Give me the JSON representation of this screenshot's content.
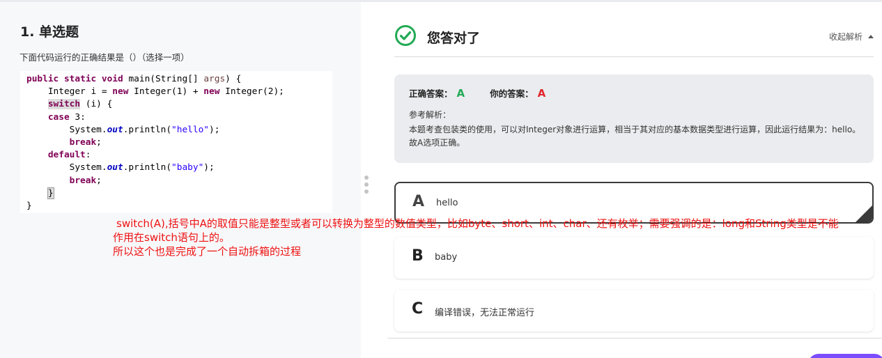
{
  "question": {
    "title": "1. 单选题",
    "description": "下面代码运行的正确结果是（）（选择一项）",
    "code": {
      "l1": {
        "kw1": "public",
        "kw2": "static",
        "kw3": "void",
        "name": "main(String[]",
        "param": "args",
        "end": ") {"
      },
      "l2": {
        "a": "Integer i = ",
        "kw1": "new",
        "b": " Integer(1) + ",
        "kw2": "new",
        "c": " Integer(2);"
      },
      "l3": {
        "kw": "switch",
        "rest": " (i) {"
      },
      "l4": {
        "kw": "case",
        "rest": " 3:"
      },
      "l5": {
        "a": "System.",
        "field": "out",
        "b": ".println(",
        "str": "\"hello\"",
        "c": ");"
      },
      "l6": {
        "kw": "break",
        "rest": ";"
      },
      "l7": {
        "kw": "default",
        "rest": ":"
      },
      "l8": {
        "a": "System.",
        "field": "out",
        "b": ".println(",
        "str": "\"baby\"",
        "c": ");"
      },
      "l9": {
        "kw": "break",
        "rest": ";"
      },
      "l10": {
        "brace": "}"
      },
      "l11": {
        "brace": "}"
      }
    }
  },
  "result": {
    "title": "您答对了",
    "collapse_label": "收起解析",
    "correct_label": "正确答案：",
    "correct_value": "A",
    "your_label": "你的答案：",
    "your_value": "A",
    "ref_label": "参考解析：",
    "ref_text": "本题考查包装类的使用，可以对Integer对象进行运算，相当于其对应的基本数据类型进行运算，因此运行结果为：hello。故A选项正确。"
  },
  "options": [
    {
      "letter": "A",
      "text": "hello"
    },
    {
      "letter": "B",
      "text": "baby"
    },
    {
      "letter": "C",
      "text": "编译错误，无法正常运行"
    }
  ],
  "note": {
    "line1": "switch(A),括号中A的取值只能是整型或者可以转换为整型的数值类型，比如byte、short、int、char、还有枚举；需要强调的是：long和String类型是不能",
    "line2": "作用在switch语句上的。",
    "line3": "所以这个也是完成了一个自动拆箱的过程"
  },
  "colors": {
    "correct": "#22aa55",
    "yours": "#e0262d",
    "note": "#ee1111",
    "accent_button": "#7c4dff"
  }
}
